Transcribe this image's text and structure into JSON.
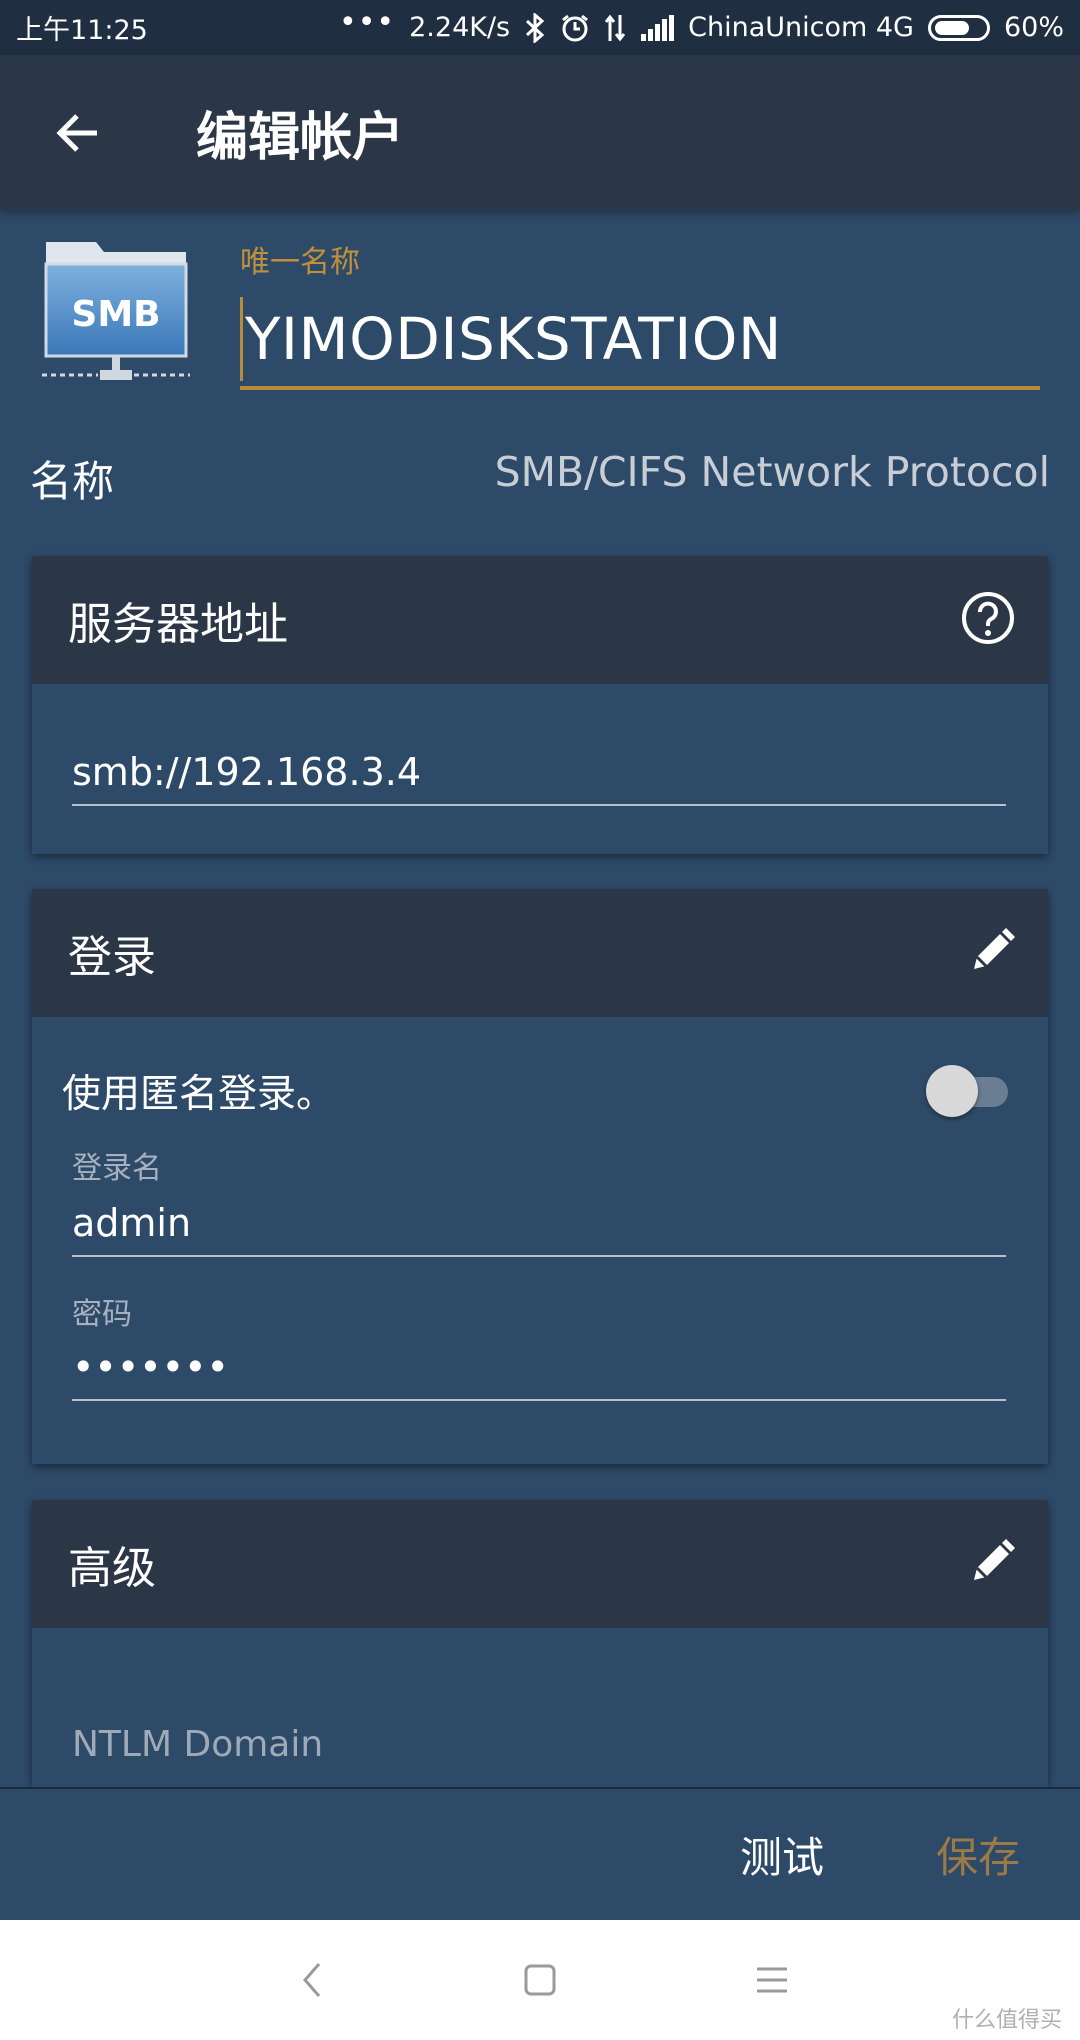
{
  "status_bar": {
    "time": "上午11:25",
    "dots": "•••",
    "speed": "2.24K/s",
    "carrier": "ChinaUnicom 4G",
    "battery": "60%",
    "battery_level": 0.6
  },
  "app_bar": {
    "title": "编辑帐户"
  },
  "account": {
    "icon_text": "SMB",
    "unique_name_label": "唯一名称",
    "unique_name_value": "YIMODISKSTATION",
    "name_label": "名称",
    "name_value": "SMB/CIFS Network Protocol"
  },
  "server_card": {
    "title": "服务器地址",
    "address_value": "smb://192.168.3.4",
    "icon": "help-circle-icon"
  },
  "login_card": {
    "title": "登录",
    "icon": "pencil-icon",
    "anonymous_label": "使用匿名登录。",
    "anonymous_on": false,
    "username_label": "登录名",
    "username_value": "admin",
    "password_label": "密码",
    "password_value": "•••••••"
  },
  "advanced_card": {
    "title": "高级",
    "icon": "pencil-icon",
    "domain_label": "NTLM Domain"
  },
  "actions": {
    "test_label": "测试",
    "save_label": "保存"
  },
  "watermark": "什么值得买",
  "colors": {
    "background": "#2e4a69",
    "header": "#2b3746",
    "accent": "#b88a3c",
    "save_disabled": "#9c7a45"
  }
}
